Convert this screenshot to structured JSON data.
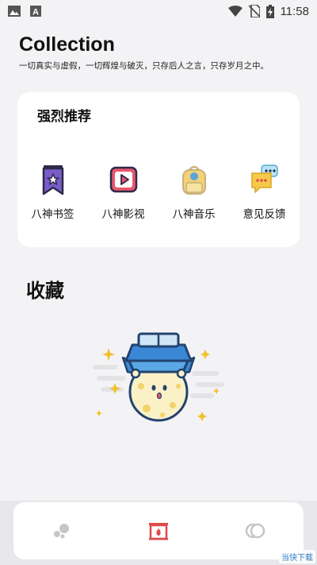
{
  "status_bar": {
    "time": "11:58",
    "icons": [
      "image-icon",
      "font-icon",
      "wifi-icon",
      "no-sim-icon",
      "battery-charging-icon"
    ]
  },
  "header": {
    "title": "Collection",
    "subtitle": "一切真实与虚假，一切辉煌与破灭，只存后人之言，只存岁月之中。"
  },
  "recommend": {
    "title": "强烈推荐",
    "items": [
      {
        "label": "八神书签",
        "icon": "bookmark-icon",
        "color": "#7a5cc8"
      },
      {
        "label": "八神影视",
        "icon": "video-icon",
        "color": "#e8576c"
      },
      {
        "label": "八神音乐",
        "icon": "backpack-icon",
        "color": "#f2d17a"
      },
      {
        "label": "意见反馈",
        "icon": "feedback-icon",
        "color": "#f7c948"
      }
    ]
  },
  "collection": {
    "title": "收藏"
  },
  "bottom_nav": {
    "tabs": [
      {
        "icon": "dots-icon",
        "active": false
      },
      {
        "icon": "fireplace-icon",
        "active": true,
        "color": "#e04a4a"
      },
      {
        "icon": "rings-icon",
        "active": false
      }
    ]
  },
  "watermark": "当快下载"
}
